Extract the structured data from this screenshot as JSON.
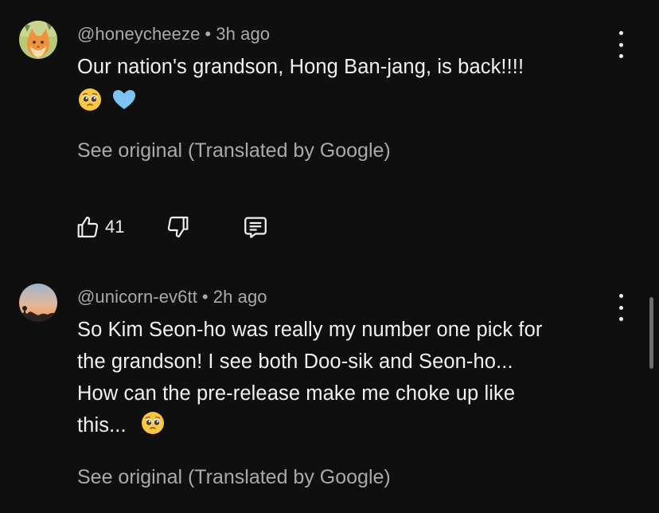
{
  "comments": [
    {
      "handle": "@honeycheeze",
      "time": "3h ago",
      "text": "Our nation's grandson, Hong Ban-jang, is back!!!!",
      "emoji": [
        "pleading-face-emoji",
        "light-blue-heart-emoji"
      ],
      "see_original": "See original (Translated by Google)",
      "likes": "41"
    },
    {
      "handle": "@unicorn-ev6tt",
      "time": "2h ago",
      "lines": [
        "So Kim Seon-ho was really my number one pick for",
        "the grandson! I see both Doo-sik and Seon-ho...",
        "How can the pre-release make me choke up like",
        "this..."
      ],
      "emoji": [
        "pleading-face-emoji"
      ],
      "see_original": "See original (Translated by Google)"
    }
  ],
  "icons": {
    "like": "thumbs-up-icon",
    "dislike": "thumbs-down-icon",
    "reply": "reply-comment-icon",
    "more": "more-vertical-icon"
  },
  "colors": {
    "background": "#0f0f0f",
    "primary_text": "#f1f1f1",
    "secondary_text": "#aaaaaa",
    "heart": "#7cc4f4"
  }
}
